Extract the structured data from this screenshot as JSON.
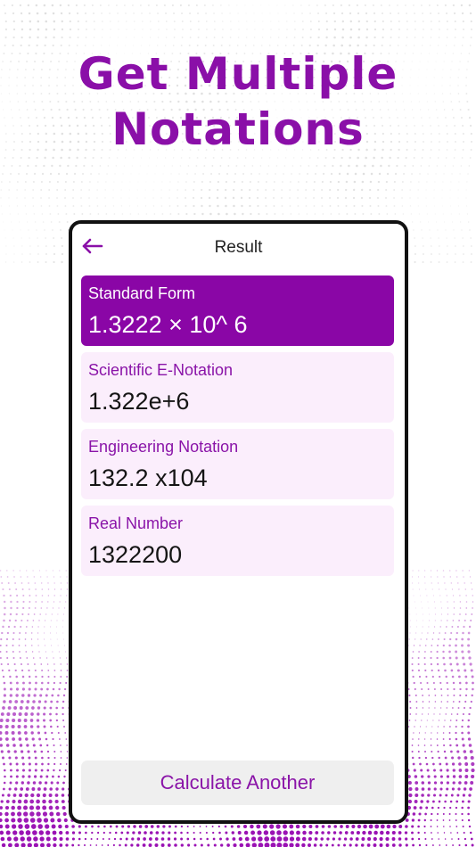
{
  "headline": {
    "line1": "Get Multiple",
    "line2": "Notations"
  },
  "colors": {
    "brand_purple": "#8a06a6",
    "card_bg": "#fbeefc",
    "button_bg": "#efefef"
  },
  "screen": {
    "back_icon": "arrow-left-icon",
    "title": "Result",
    "results": [
      {
        "label": "Standard Form",
        "value": "1.3222 × 10^ 6",
        "selected": true
      },
      {
        "label": "Scientific E-Notation",
        "value": "1.322e+6",
        "selected": false
      },
      {
        "label": "Engineering Notation",
        "value": "132.2 x104",
        "selected": false
      },
      {
        "label": "Real Number",
        "value": "1322200",
        "selected": false
      }
    ],
    "calculate_button": "Calculate Another"
  }
}
